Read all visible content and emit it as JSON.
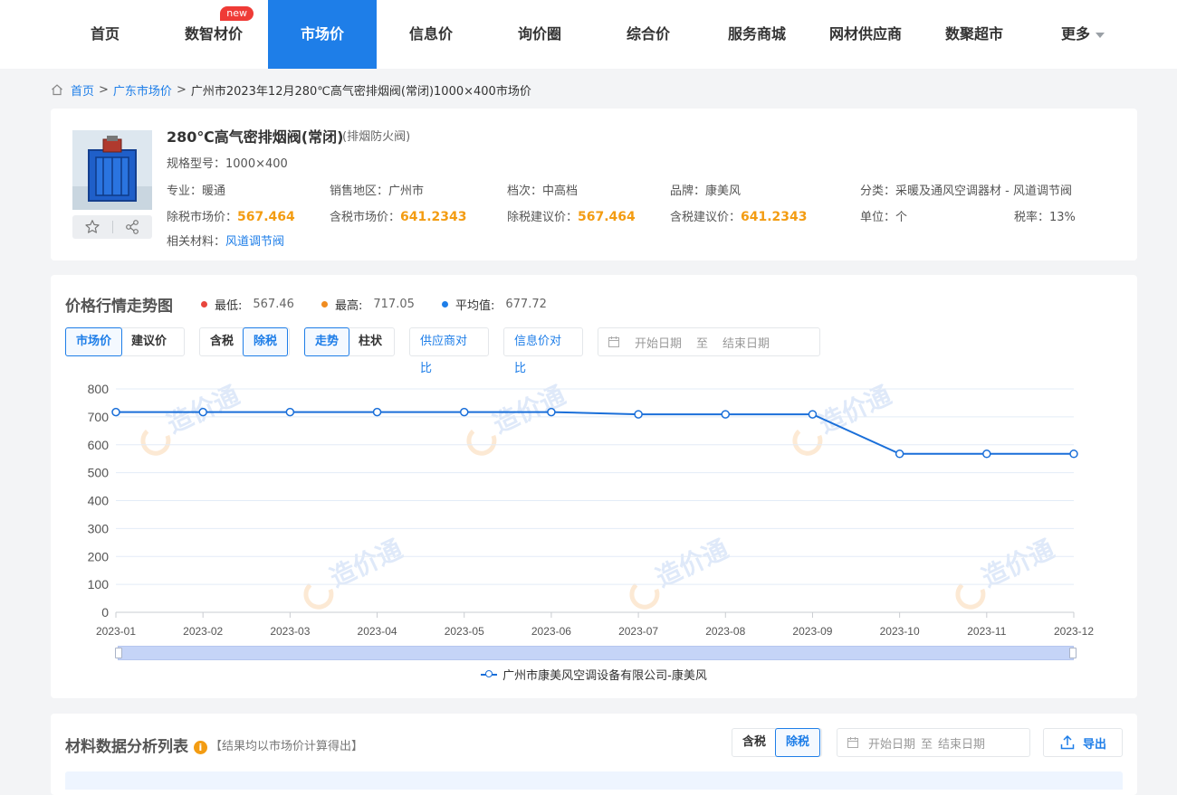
{
  "nav": {
    "items": [
      {
        "label": "首页"
      },
      {
        "label": "数智材价",
        "badge": "new"
      },
      {
        "label": "市场价",
        "active": true
      },
      {
        "label": "信息价"
      },
      {
        "label": "询价圈"
      },
      {
        "label": "综合价"
      },
      {
        "label": "服务商城"
      },
      {
        "label": "网材供应商"
      },
      {
        "label": "数聚超市"
      },
      {
        "label": "更多"
      }
    ]
  },
  "breadcrumb": {
    "home": "首页",
    "sep": ">",
    "region": "广东市场价",
    "current": "广州市2023年12月280℃高气密排烟阀(常闭)1000×400市场价"
  },
  "product": {
    "title": "280℃高气密排烟阀(常闭)",
    "category": "(排烟防火阀)",
    "spec_label": "规格型号：",
    "spec": "1000×400",
    "major_label": "专业：",
    "major": "暖通",
    "area_label": "销售地区：",
    "area": "广州市",
    "grade_label": "档次：",
    "grade": "中高档",
    "brand_label": "品牌：",
    "brand": "康美风",
    "class_label": "分类：",
    "class": "采暖及通风空调器材 - 风道调节阀",
    "ex_market_label": "除税市场价：",
    "ex_market": "567.464",
    "in_market_label": "含税市场价：",
    "in_market": "641.2343",
    "ex_suggest_label": "除税建议价：",
    "ex_suggest": "567.464",
    "in_suggest_label": "含税建议价：",
    "in_suggest": "641.2343",
    "unit_label": "单位：",
    "unit": "个",
    "tax_label": "税率：",
    "tax": "13%",
    "related_label": "相关材料：",
    "related": "风道调节阀"
  },
  "trend": {
    "title": "价格行情走势图",
    "min_label": "最低:",
    "min": "567.46",
    "max_label": "最高:",
    "max": "717.05",
    "avg_label": "平均值:",
    "avg": "677.72",
    "btn_market": "市场价",
    "btn_suggest": "建议价",
    "btn_tax_in": "含税",
    "btn_tax_ex": "除税",
    "btn_trend": "走势",
    "btn_bar": "柱状",
    "btn_supplier": "供应商对比",
    "btn_info": "信息价对比",
    "date_start": "开始日期",
    "date_to": "至",
    "date_end": "结束日期",
    "watermark": "造价通",
    "colors": {
      "min": "#e8453c",
      "max": "#f08c1f",
      "avg": "#1e7ee8",
      "line": "#1a6fd9"
    }
  },
  "chart_data": {
    "type": "line",
    "categories": [
      "2023-01",
      "2023-02",
      "2023-03",
      "2023-04",
      "2023-05",
      "2023-06",
      "2023-07",
      "2023-08",
      "2023-09",
      "2023-10",
      "2023-11",
      "2023-12"
    ],
    "series": [
      {
        "name": "广州市康美风空调设备有限公司-康美风",
        "values": [
          717.05,
          717.05,
          717.05,
          717.05,
          717.05,
          717.05,
          709,
          709,
          709,
          567.46,
          567.46,
          567.46
        ]
      }
    ],
    "yticks": [
      "800",
      "700",
      "600",
      "500",
      "400",
      "300",
      "200",
      "100",
      "0"
    ],
    "ylim": [
      0,
      800
    ],
    "grid": true,
    "legend": "bottom"
  },
  "analysis": {
    "title": "材料数据分析列表",
    "info_icon": "i",
    "note": "【结果均以市场价计算得出】",
    "btn_tax_in": "含税",
    "btn_tax_ex": "除税",
    "date_start": "开始日期",
    "date_to": "至",
    "date_end": "结束日期",
    "export": "导出"
  }
}
